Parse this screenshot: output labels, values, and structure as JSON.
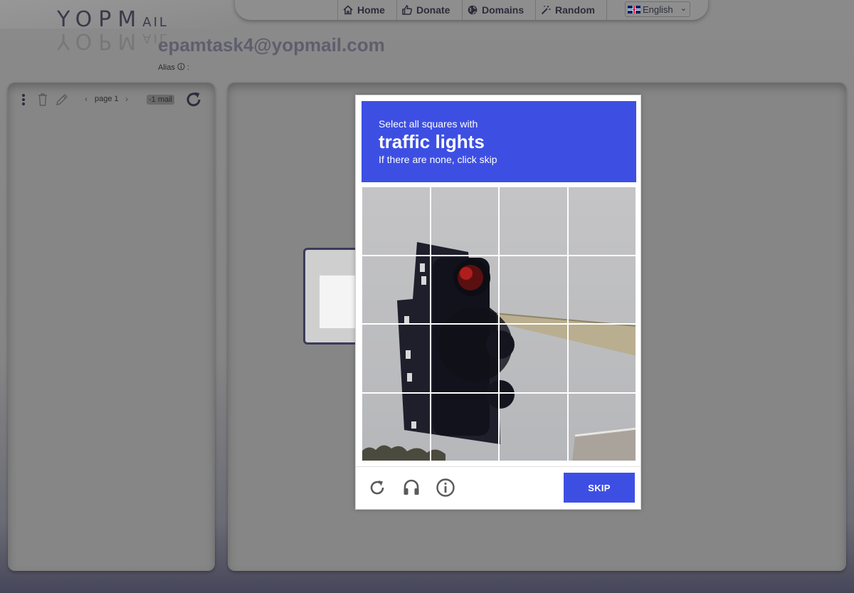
{
  "logo": {
    "main": "YOPM",
    "small": "AIL"
  },
  "nav": {
    "home": "Home",
    "donate": "Donate",
    "domains": "Domains",
    "random": "Random",
    "language": "English"
  },
  "inbox": {
    "email": "epamtask4@yopmail.com",
    "alias_label": "Alias",
    "alias_suffix": ":",
    "page_label": "page 1",
    "mail_count": "-1 mail"
  },
  "challenge": {
    "line1": "Select all squares with",
    "target": "traffic lights",
    "line3": "If there are none, click skip",
    "skip_label": "SKIP",
    "grid_rows": 4,
    "grid_cols": 4
  },
  "colors": {
    "accent": "#3d4fe3",
    "overlay": "#868686"
  },
  "icons": [
    "home-icon",
    "thumbs-up-icon",
    "globe-icon",
    "magic-wand-icon",
    "more-vertical-icon",
    "trash-icon",
    "pencil-icon",
    "refresh-icon",
    "headphones-icon",
    "info-icon"
  ]
}
